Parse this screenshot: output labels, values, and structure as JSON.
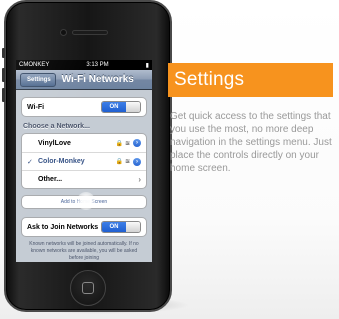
{
  "phone": {
    "status": {
      "carrier": "CMONKEY",
      "time": "3:13 PM",
      "battery": "▮"
    },
    "nav": {
      "back_label": "Settings",
      "title": "Wi-Fi Networks"
    },
    "wifi": {
      "label": "Wi-Fi",
      "toggle": "ON"
    },
    "section_title": "Choose a Network...",
    "networks": [
      {
        "name": "VinylLove",
        "selected": false,
        "lock": "🔒",
        "wifi": "≋",
        "detail": "›"
      },
      {
        "name": "Color-Monkey",
        "selected": true,
        "check": "✓",
        "lock": "🔒",
        "wifi": "≋",
        "detail": "›"
      },
      {
        "name": "Other...",
        "chevron": "›"
      }
    ],
    "add_home_label": "Add to Home Screen",
    "ask": {
      "label": "Ask to Join Networks",
      "toggle": "ON"
    },
    "footnote": "Known networks will be joined automatically. If no known networks are available, you will be asked before joining"
  },
  "promo": {
    "title": "Settings",
    "description": "Get quick access to the settings that you use the most, no more deep navigation in the settings menu. Just place the controls directly on your home screen."
  },
  "colors": {
    "accent": "#f7931e",
    "toggle_on": "#2d6ee0",
    "description_text": "#999999"
  }
}
